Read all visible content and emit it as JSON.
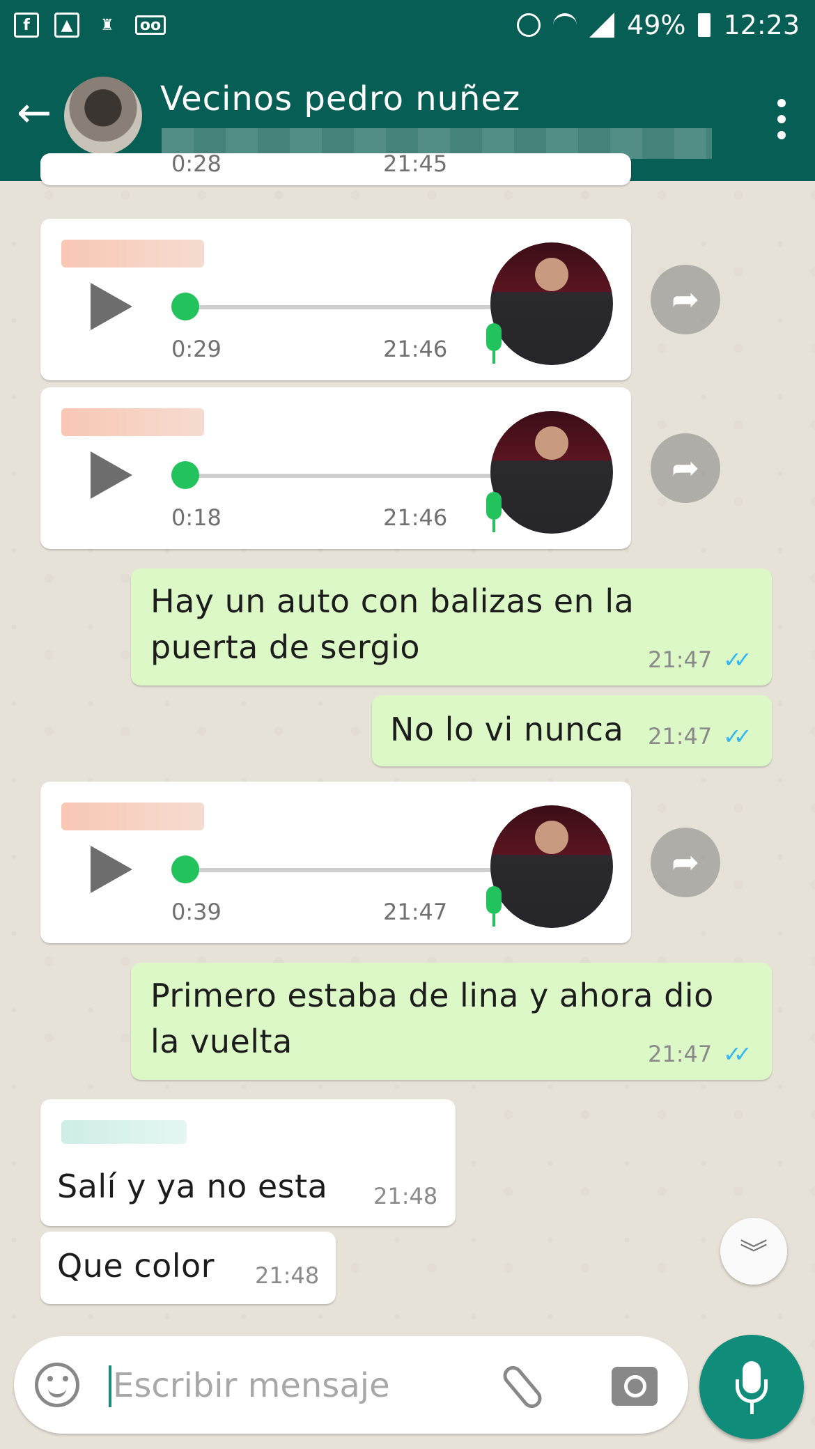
{
  "status_bar": {
    "battery": "49%",
    "time": "12:23",
    "icons": [
      "facebook-icon",
      "gallery-icon",
      "cleaner-icon",
      "voicemail-icon",
      "alarm-icon",
      "wifi-icon",
      "signal-icon",
      "battery-icon"
    ]
  },
  "header": {
    "title": "Vecinos pedro nuñez",
    "back_icon": "←",
    "menu_icon": "more-vert-icon"
  },
  "messages": [
    {
      "type": "voice",
      "direction": "in",
      "duration": "0:28",
      "time": "21:45",
      "partial": true
    },
    {
      "type": "voice",
      "direction": "in",
      "duration": "0:29",
      "time": "21:46"
    },
    {
      "type": "voice",
      "direction": "in",
      "duration": "0:18",
      "time": "21:46"
    },
    {
      "type": "text",
      "direction": "out",
      "lines": [
        "Hay un auto con balizas en la",
        "puerta de sergio"
      ],
      "time": "21:47",
      "ticks": "✓✓"
    },
    {
      "type": "text",
      "direction": "out",
      "lines": [
        "No lo vi nunca"
      ],
      "time": "21:47",
      "ticks": "✓✓"
    },
    {
      "type": "voice",
      "direction": "in",
      "duration": "0:39",
      "time": "21:47"
    },
    {
      "type": "text",
      "direction": "out",
      "lines": [
        "Primero estaba de lina y ahora dio",
        "la vuelta"
      ],
      "time": "21:47",
      "ticks": "✓✓"
    },
    {
      "type": "text",
      "direction": "in",
      "lines": [
        "Salí y ya no esta"
      ],
      "time": "21:48"
    },
    {
      "type": "text",
      "direction": "in",
      "lines": [
        "Que color"
      ],
      "time": "21:48"
    }
  ],
  "share_icon": "➦",
  "scroll_down_icon": "︾",
  "input": {
    "placeholder": "Escribir mensaje"
  },
  "colors": {
    "header": "#075e54",
    "outgoing_bubble": "#dcf8c6",
    "incoming_bubble": "#ffffff",
    "fab": "#0f8c7a",
    "voice_accent": "#22c35d",
    "read_ticks": "#34b7f1"
  }
}
